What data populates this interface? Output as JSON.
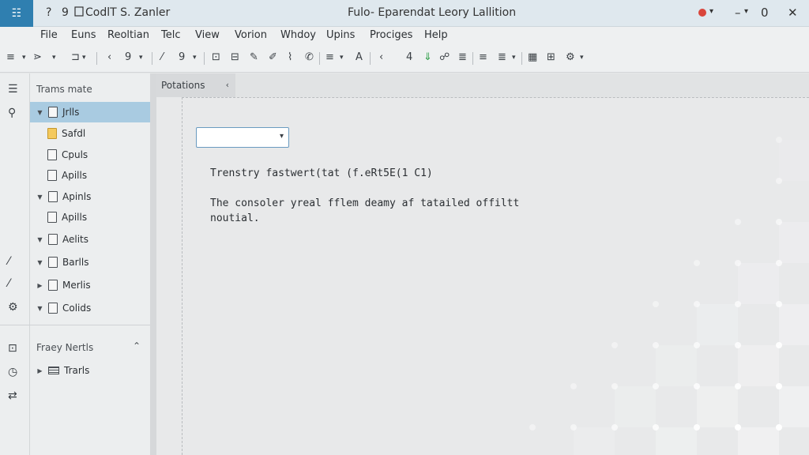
{
  "window": {
    "quick_icons": [
      "?",
      "9"
    ],
    "document": "CodlT S. Zanler",
    "title": "Fulo- Eparendat Leory Lallition",
    "controls": {
      "recording": "record-icon",
      "minimize": "–",
      "maximize": "0",
      "close": "✕"
    }
  },
  "menu": [
    "File",
    "Euns",
    "Reoltian",
    "Telc",
    "View",
    "Vorion",
    "Whdoy",
    "Upins",
    "Prociges",
    "Help"
  ],
  "toolbar": {
    "groups": [
      [
        "≡",
        "⋗",
        "⊐"
      ],
      [
        "‹",
        "9"
      ],
      [
        "⁄",
        "9"
      ],
      [
        "⊡",
        "⊟",
        "✎",
        "✐",
        "⌇",
        "✆"
      ],
      [
        "≡",
        "A"
      ],
      [
        "‹",
        "4",
        "⇓",
        "☍",
        "≣"
      ],
      [
        "≡",
        "≣"
      ],
      [
        "▦",
        "⊞",
        "⚙"
      ]
    ]
  },
  "explorer": {
    "title": "Trams mate",
    "items": [
      {
        "label": "Jrlls",
        "depth": 0,
        "expanded": true,
        "selected": true,
        "icon": "file"
      },
      {
        "label": "Safdl",
        "depth": 1,
        "icon": "folder"
      },
      {
        "label": "Cpuls",
        "depth": 1,
        "icon": "file"
      },
      {
        "label": "Apills",
        "depth": 1,
        "icon": "file"
      },
      {
        "label": "Apinls",
        "depth": 0,
        "expanded": true,
        "icon": "file"
      },
      {
        "label": "Apills",
        "depth": 1,
        "icon": "file"
      },
      {
        "label": "Aelits",
        "depth": 0,
        "expanded": true,
        "icon": "file"
      },
      {
        "label": "Barlls",
        "depth": 0,
        "expanded": true,
        "icon": "file"
      },
      {
        "label": "Merlis",
        "depth": 0,
        "expanded": false,
        "icon": "file"
      },
      {
        "label": "Colids",
        "depth": 0,
        "expanded": true,
        "icon": "file"
      }
    ],
    "section2": {
      "title": "Fraey Nertls",
      "items": [
        {
          "label": "Trarls",
          "expanded": false
        }
      ]
    }
  },
  "editor": {
    "tab": "Potations",
    "dropdown": {
      "value": ""
    },
    "text_line1": "Trenstry fastwert(tat (f.eRt5E(1 C1)",
    "text_line2": "The consoler yreal fflem deamy af tatailed offiltt\nnoutial."
  }
}
